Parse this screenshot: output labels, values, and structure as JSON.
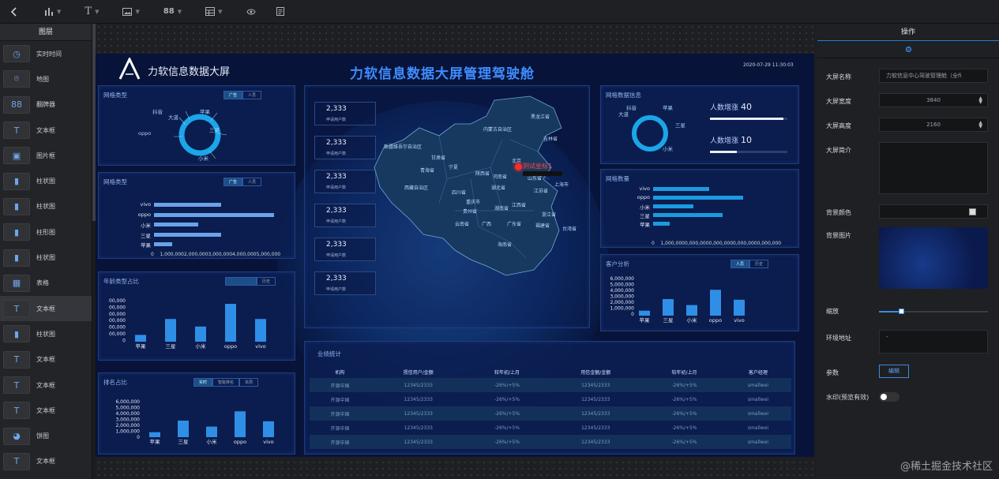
{
  "toolbar": {
    "items": [
      "back",
      "chart",
      "text",
      "image",
      "grid",
      "table",
      "preview",
      "edit"
    ]
  },
  "layers": {
    "title": "图层",
    "items": [
      {
        "label": "实时时间",
        "icon": "clock-icon"
      },
      {
        "label": "地图",
        "icon": "map-pin-icon"
      },
      {
        "label": "翻牌器",
        "icon": "flip-counter-icon"
      },
      {
        "label": "文本框",
        "icon": "text-icon"
      },
      {
        "label": "图片框",
        "icon": "image-icon"
      },
      {
        "label": "柱状图",
        "icon": "bar-chart-icon"
      },
      {
        "label": "柱状图",
        "icon": "bar-chart-icon"
      },
      {
        "label": "柱形图",
        "icon": "bar-chart-icon"
      },
      {
        "label": "柱状图",
        "icon": "bar-chart-icon"
      },
      {
        "label": "表格",
        "icon": "table-icon"
      },
      {
        "label": "文本框",
        "icon": "text-icon"
      },
      {
        "label": "柱状图",
        "icon": "bar-chart-icon"
      },
      {
        "label": "文本框",
        "icon": "text-icon"
      },
      {
        "label": "文本框",
        "icon": "text-icon"
      },
      {
        "label": "文本框",
        "icon": "text-icon"
      },
      {
        "label": "饼图",
        "icon": "pie-chart-icon"
      },
      {
        "label": "文本框",
        "icon": "text-icon"
      }
    ]
  },
  "screen": {
    "brand": "力软信息数据大屏",
    "title": "力软信息数据大屏管理驾驶舱",
    "datetime": "2020-07-29 11:30:03",
    "donut1": {
      "title": "网格类型",
      "tabs": [
        "广告",
        "人员"
      ],
      "labels": [
        "抖音",
        "苹果",
        "大道",
        "三星",
        "oppo",
        "小米"
      ]
    },
    "bar1": {
      "title": "网格类型",
      "tabs": [
        "广告",
        "人员"
      ],
      "categories": [
        "vivo",
        "oppo",
        "小米",
        "三星",
        "苹果"
      ],
      "values": [
        0.55,
        0.98,
        0.36,
        0.55,
        0.15
      ],
      "ticks": "0    1,000,0002,000,0003,000,0004,000,0005,000,000"
    },
    "age": {
      "title": "年龄类型占比",
      "tab": "历史",
      "categories": [
        "苹果",
        "三星",
        "小米",
        "oppo",
        "vivo"
      ],
      "values": [
        0.18,
        0.6,
        0.4,
        1.0,
        0.6
      ],
      "ylabels": [
        "00,000",
        "00,000",
        "00,000",
        "00,000",
        "00,000",
        "00,000",
        "0"
      ]
    },
    "sales": {
      "title": "排名占比",
      "tabs": [
        "实时",
        "智能排名",
        "本周"
      ],
      "categories": [
        "苹果",
        "三星",
        "小米",
        "oppo",
        "vivo"
      ],
      "values": [
        0.15,
        0.5,
        0.32,
        0.78,
        0.48
      ],
      "ylabels": [
        "6,000,000",
        "5,000,000",
        "4,000,000",
        "3,000,000",
        "2,000,000",
        "1,000,000",
        "0"
      ]
    },
    "counters": [
      {
        "value": "2,333",
        "label": "申请用户数"
      },
      {
        "value": "2,333",
        "label": "申请用户数"
      },
      {
        "value": "2,333",
        "label": "申请用户数"
      },
      {
        "value": "2,333",
        "label": "申请用户数"
      },
      {
        "value": "2,333",
        "label": "申请用户数"
      },
      {
        "value": "2,333",
        "label": "申请用户数"
      }
    ],
    "map": {
      "marker": "测试坐标1",
      "regions": [
        "黑龙江省",
        "内蒙古自治区",
        "吉林省",
        "新疆维吾尔自治区",
        "甘肃省",
        "宁夏",
        "北京",
        "西藏自治区",
        "青海省",
        "陕西省",
        "河南省",
        "山东省",
        "四川省",
        "湖北省",
        "江苏省",
        "重庆市",
        "贵州省",
        "湖南省",
        "江西省",
        "浙江省",
        "云南省",
        "广西",
        "广东省",
        "福建省",
        "台湾省",
        "海南省",
        "上海市"
      ]
    },
    "donut2": {
      "title": "网格数据信息",
      "labels": [
        "抖音",
        "苹果",
        "大道",
        "三星",
        "小米"
      ],
      "kpis": [
        {
          "label": "人数增涨",
          "value": "40",
          "fill": 0.95
        },
        {
          "label": "人数增涨",
          "value": "10",
          "fill": 0.35
        }
      ]
    },
    "bar2": {
      "title": "网格数量",
      "categories": [
        "vivo",
        "oppo",
        "小米",
        "三星",
        "苹果"
      ],
      "values": [
        0.45,
        0.72,
        0.32,
        0.56,
        0.13
      ],
      "ticks": "0    1,000,0000,000,0000,000,0000,000,0000,000,000"
    },
    "customers": {
      "title": "客户分析",
      "tabs": [
        "人员",
        "历史"
      ],
      "categories": [
        "苹果",
        "三星",
        "小米",
        "oppo",
        "vivo"
      ],
      "values": [
        0.15,
        0.5,
        0.32,
        0.78,
        0.48
      ],
      "ylabels": [
        "6,000,000",
        "5,000,000",
        "4,000,000",
        "3,000,000",
        "2,000,000",
        "1,000,000",
        "0"
      ]
    },
    "table": {
      "title": "业绩统计",
      "headers": [
        "机构",
        "授信用户/金额",
        "较年初/上月",
        "用信金额/金额",
        "较年初/上月",
        "客户经理"
      ],
      "rows": [
        [
          "开源中国",
          "12345/2333",
          "-26%/+5%",
          "12345/2333",
          "-26%/+5%",
          "smallwei"
        ],
        [
          "开源中国",
          "12345/2333",
          "-26%/+5%",
          "12345/2333",
          "-26%/+5%",
          "smallwei"
        ],
        [
          "开源中国",
          "12345/2333",
          "-26%/+5%",
          "12345/2333",
          "-26%/+5%",
          "smallwei"
        ],
        [
          "开源中国",
          "12345/2333",
          "-26%/+5%",
          "12345/2333",
          "-26%/+5%",
          "smallwei"
        ],
        [
          "开源中国",
          "12345/2333",
          "-26%/+5%",
          "12345/2333",
          "-26%/+5%",
          "smallwei"
        ]
      ]
    }
  },
  "props": {
    "title": "操作",
    "name_label": "大屏名称",
    "name_value": "力软信息中心驾驶管理舱（全fi",
    "width_label": "大屏宽度",
    "width_value": "3840",
    "height_label": "大屏高度",
    "height_value": "2160",
    "desc_label": "大屏简介",
    "bg_color_label": "背景颜色",
    "bg_image_label": "背景图片",
    "zoom_label": "缩放",
    "zoom_fraction": 0.2,
    "env_label": "环境地址",
    "env_value": "-",
    "param_label": "参数",
    "param_button": "编辑",
    "watermark_label": "水印(预览有效)",
    "watermark_on": false
  },
  "watermark": "@稀土掘金技术社区"
}
